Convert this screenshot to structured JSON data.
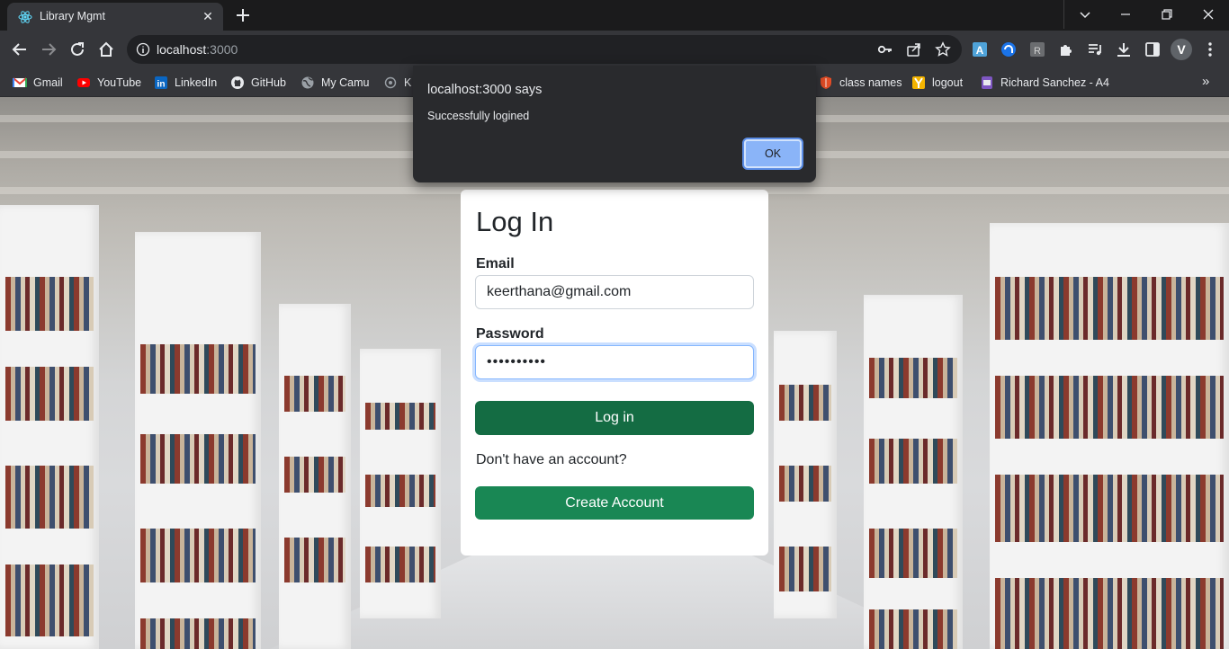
{
  "browser": {
    "tab": {
      "title": "Library Mgmt",
      "close_glyph": "✕",
      "favicon": "react-icon"
    },
    "address": {
      "host": "localhost",
      "port": ":3000"
    },
    "bookmarks": [
      {
        "label": "Gmail",
        "icon": "gmail-icon"
      },
      {
        "label": "YouTube",
        "icon": "youtube-icon"
      },
      {
        "label": "LinkedIn",
        "icon": "linkedin-icon"
      },
      {
        "label": "GitHub",
        "icon": "github-icon"
      },
      {
        "label": "My Camu",
        "icon": "globe-icon"
      },
      {
        "label": "K",
        "icon": "circle-icon"
      },
      {
        "label": "class names",
        "icon": "shield-icon"
      },
      {
        "label": "logout",
        "icon": "y-icon"
      },
      {
        "label": "Richard Sanchez - A4",
        "icon": "doc-icon"
      }
    ],
    "more_glyph": "»",
    "profile_initial": "V"
  },
  "dialog": {
    "title": "localhost:3000 says",
    "message": "Successfully logined",
    "ok_label": "OK"
  },
  "login": {
    "title": "Log In",
    "email_label": "Email",
    "email_value": "keerthana@gmail.com",
    "password_label": "Password",
    "password_mask": "••••••••••",
    "login_button": "Log in",
    "no_account_text": "Don't have an account?",
    "create_button": "Create Account"
  },
  "colors": {
    "login_button": "#146c43",
    "create_button": "#198754",
    "dialog_ok": "#8ab4f8"
  }
}
